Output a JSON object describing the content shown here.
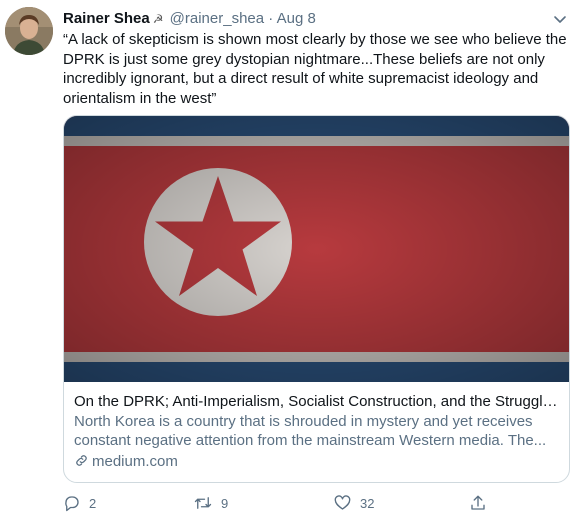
{
  "tweet": {
    "author_name": "Rainer Shea",
    "author_emoji": "☭",
    "handle": "@rainer_shea",
    "separator": "·",
    "date": "Aug 8",
    "text": "“A lack of skepticism is shown most clearly by those we see who believe the DPRK is just some grey dystopian nightmare...These beliefs are not only incredibly ignorant, but a direct result of white supremacist ideology and orientalism in the west”"
  },
  "card": {
    "title": "On the DPRK; Anti-Imperialism, Socialist Construction, and the Struggle ...",
    "description": "North Korea is a country that is shrouded in mystery and yet receives constant negative attention from the mainstream Western media. The...",
    "domain": "medium.com"
  },
  "actions": {
    "replies": "2",
    "retweets": "9",
    "likes": "32"
  },
  "colors": {
    "text": "#0f1419",
    "secondary": "#5b7083",
    "border": "#cfd9de",
    "flag_blue": "#2a4f7a",
    "flag_red": "#b73a3e"
  }
}
